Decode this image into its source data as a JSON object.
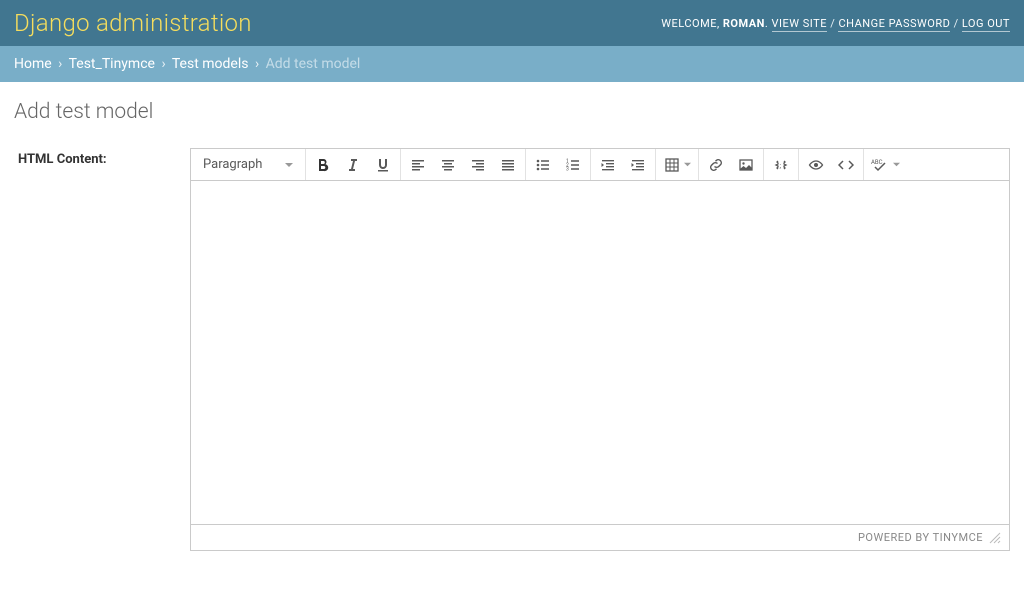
{
  "header": {
    "branding": "Django administration",
    "welcome": "WELCOME,",
    "username": "ROMAN",
    "view_site": "VIEW SITE",
    "change_password": "CHANGE PASSWORD",
    "log_out": "LOG OUT"
  },
  "breadcrumb": {
    "home": "Home",
    "app": "Test_Tinymce",
    "model": "Test models",
    "final": "Add test model"
  },
  "page": {
    "title": "Add test model"
  },
  "form": {
    "html_content_label": "HTML Content:"
  },
  "editor": {
    "format_value": "Paragraph",
    "powered_by": "POWERED BY TINYMCE"
  }
}
